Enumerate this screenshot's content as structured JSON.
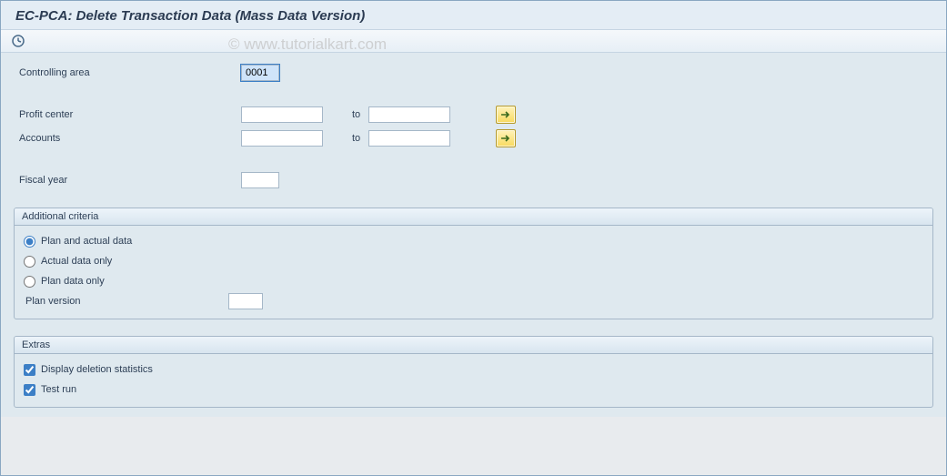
{
  "title": "EC-PCA: Delete Transaction Data (Mass Data Version)",
  "watermark": "© www.tutorialkart.com",
  "fields": {
    "controlling_area": {
      "label": "Controlling area",
      "value": "0001"
    },
    "profit_center": {
      "label": "Profit center",
      "from": "",
      "to_label": "to",
      "to": ""
    },
    "accounts": {
      "label": "Accounts",
      "from": "",
      "to_label": "to",
      "to": ""
    },
    "fiscal_year": {
      "label": "Fiscal year",
      "value": ""
    }
  },
  "groups": {
    "additional_criteria": {
      "title": "Additional criteria",
      "opt_plan_actual": "Plan and actual data",
      "opt_actual_only": "Actual data only",
      "opt_plan_only": "Plan data only",
      "plan_version_label": "Plan version",
      "plan_version_value": ""
    },
    "extras": {
      "title": "Extras",
      "display_stats": "Display deletion statistics",
      "test_run": "Test run"
    }
  }
}
